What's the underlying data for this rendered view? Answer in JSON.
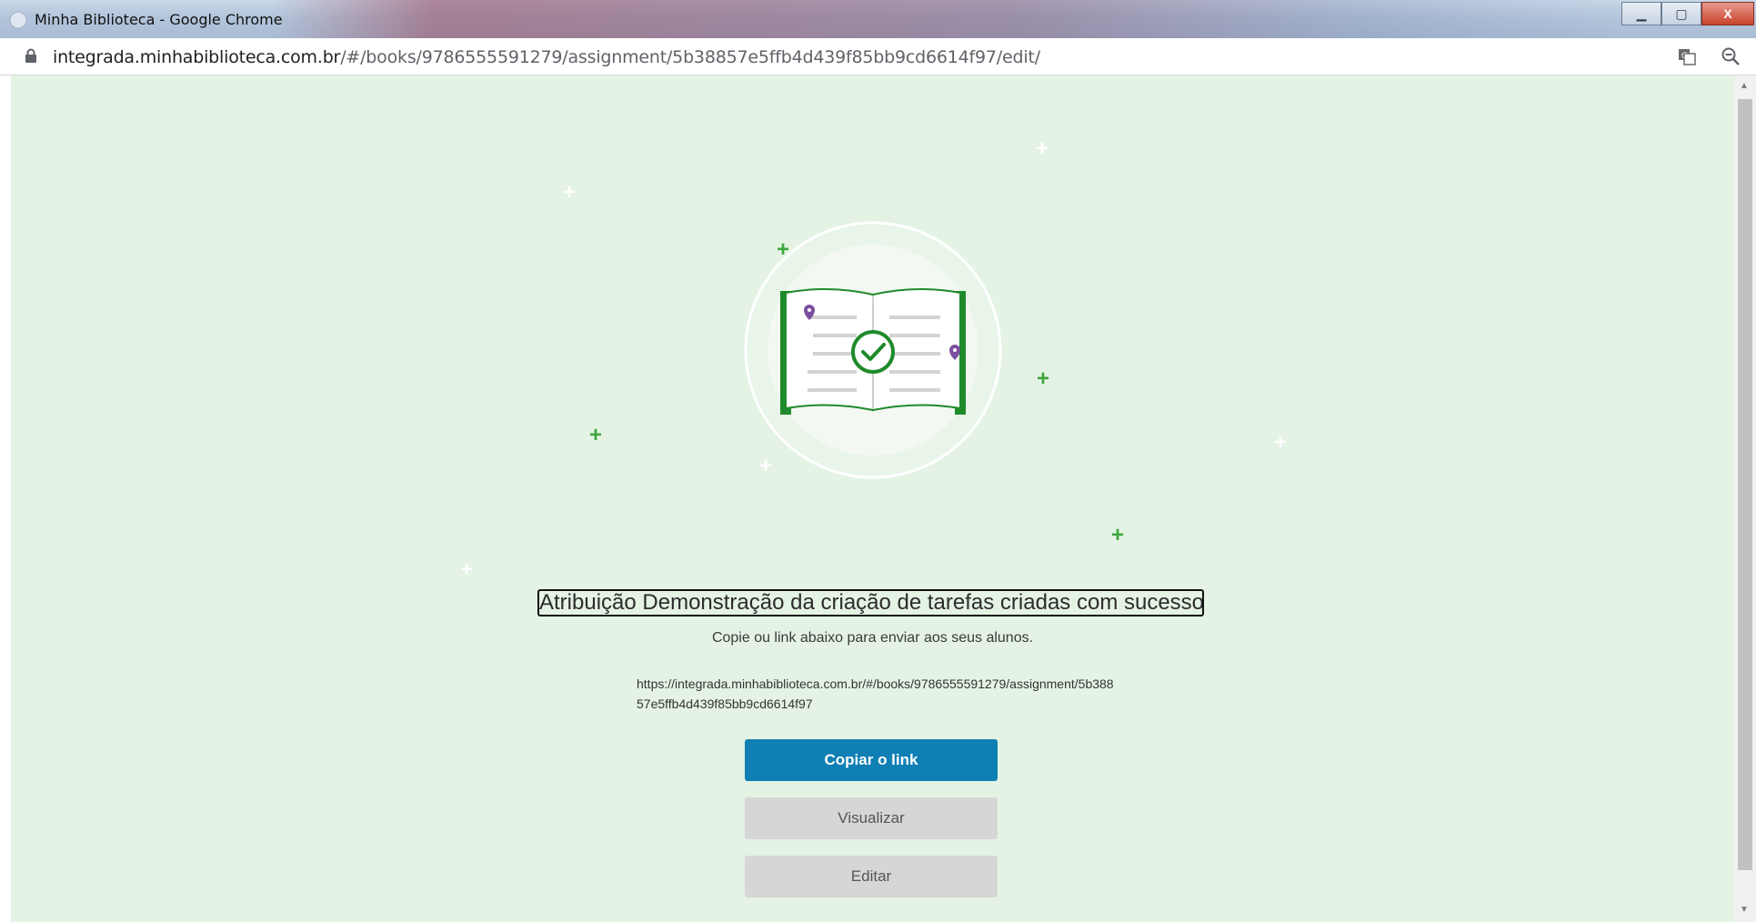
{
  "window": {
    "title": "Minha Biblioteca - Google Chrome",
    "minimize_label": "▁",
    "maximize_label": "▢",
    "close_label": "X"
  },
  "address_bar": {
    "host": "integrada.minhabiblioteca.com.br",
    "path": "/#/books/9786555591279/assignment/5b38857e5ffb4d439f85bb9cd6614f97/edit/"
  },
  "page": {
    "headline": "Atribuição Demonstração da criação de tarefas criadas com sucesso!",
    "subtitle": "Copie ou link abaixo para enviar aos seus alunos.",
    "assignment_link": "https://integrada.minhabiblioteca.com.br/#/books/9786555591279/assignment/5b38857e5ffb4d439f85bb9cd6614f97",
    "buttons": {
      "copy": "Copiar o link",
      "view": "Visualizar",
      "edit": "Editar"
    }
  },
  "colors": {
    "background": "#e4f3e4",
    "primary_button": "#0f7fb4",
    "secondary_button": "#d6d6d6",
    "book_green": "#1f8a2a",
    "accent_green": "#3fa63f",
    "pin_purple": "#7b4f9e"
  },
  "icons": [
    "lock-icon",
    "translate-icon",
    "zoom-out-icon",
    "book-check-icon",
    "bookmark-pin-icon"
  ]
}
